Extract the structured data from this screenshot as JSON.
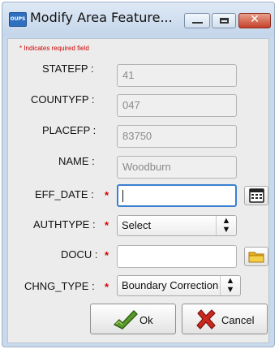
{
  "window": {
    "title": "Modify Area Feature...",
    "app_icon_text": "OUPS"
  },
  "form": {
    "required_note": "* Indicates required field",
    "fields": {
      "statefp": {
        "label": "STATEFP :",
        "value": "41"
      },
      "countyfp": {
        "label": "COUNTYFP :",
        "value": "047"
      },
      "placefp": {
        "label": "PLACEFP :",
        "value": "83750"
      },
      "name": {
        "label": "NAME :",
        "value": "Woodburn"
      },
      "eff_date": {
        "label": "EFF_DATE :",
        "required": "*",
        "value": ""
      },
      "authtype": {
        "label": "AUTHTYPE :",
        "required": "*",
        "selected": "Select"
      },
      "docu": {
        "label": "DOCU :",
        "required": "*",
        "value": ""
      },
      "chng_type": {
        "label": "CHNG_TYPE :",
        "required": "*",
        "selected": "Boundary Correction"
      }
    }
  },
  "buttons": {
    "ok": "Ok",
    "cancel": "Cancel"
  },
  "icons": {
    "calendar": "calendar-icon",
    "folder": "folder-icon",
    "ok": "green-checkmark-icon",
    "cancel": "red-x-icon"
  },
  "colors": {
    "required": "#d60000",
    "focus": "#3a7fd0",
    "close_button": "#c4412a"
  }
}
